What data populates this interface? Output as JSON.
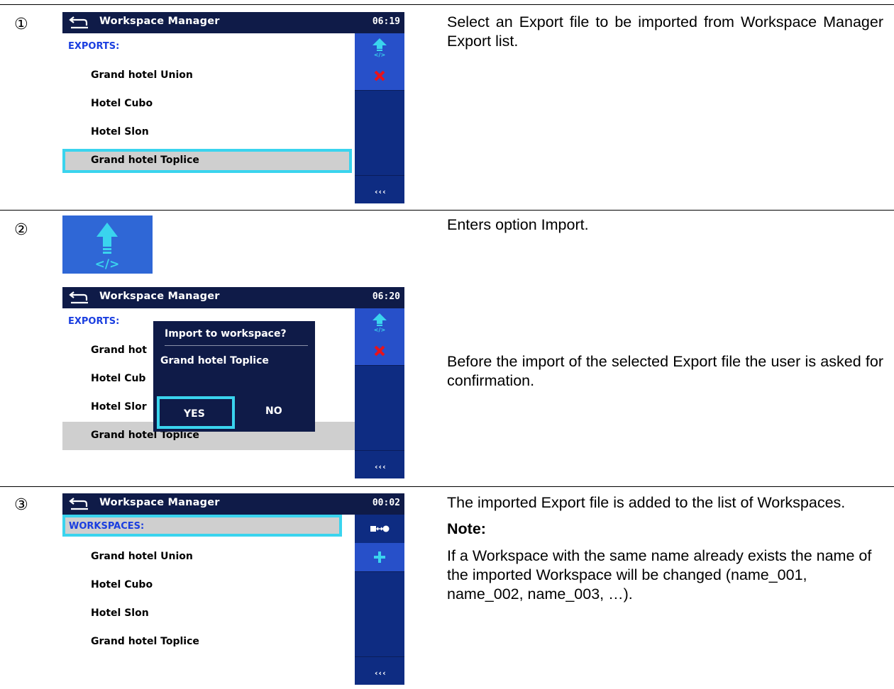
{
  "colors": {
    "titlebar": "#0f1b48",
    "sidebar": "#0e2c82",
    "accent_button": "#2750c9",
    "highlight": "#3ad4ee",
    "header_text": "#1a3ee0",
    "selected_row": "#cfcfcf"
  },
  "steps": [
    {
      "marker": "①",
      "screen": {
        "title": "Workspace Manager",
        "clock": "06:19",
        "header": "EXPORTS:",
        "items": [
          "Grand hotel Union",
          "Hotel Cubo",
          "Hotel Slon",
          "Grand hotel Toplice"
        ],
        "selected_index": 3,
        "side_buttons": [
          "import-icon",
          "delete-icon"
        ],
        "more": "‹‹‹"
      },
      "text": "Select an Export file to be imported from Workspace Manager Export list."
    },
    {
      "marker": "②",
      "icon": "import-icon",
      "text": "Enters option Import.",
      "screen": {
        "title": "Workspace Manager",
        "clock": "06:20",
        "header": "EXPORTS:",
        "items": [
          "Grand hot",
          "Hotel Cub",
          "Hotel Slor",
          "Grand hotel Toplice"
        ],
        "dialog": {
          "question": "Import to workspace?",
          "value": "Grand hotel Toplice",
          "yes": "YES",
          "no": "NO"
        },
        "more": "‹‹‹"
      },
      "text2": "Before the import of the selected Export file the user is asked for confirmation."
    },
    {
      "marker": "③",
      "screen": {
        "title": "Workspace Manager",
        "clock": "00:02",
        "header": "WORKSPACES:",
        "items": [
          "Grand hotel Union",
          "Hotel Cubo",
          "Hotel Slon",
          "Grand hotel Toplice"
        ],
        "side_buttons": [
          "switch-icon",
          "add-icon"
        ],
        "more": "‹‹‹"
      },
      "text": "The imported Export file is added to the list of Workspaces.",
      "note_heading": "Note:",
      "note": "If a Workspace with the same name already exists the name of the imported Workspace will be changed (name_001, name_002, name_003, …)."
    }
  ]
}
